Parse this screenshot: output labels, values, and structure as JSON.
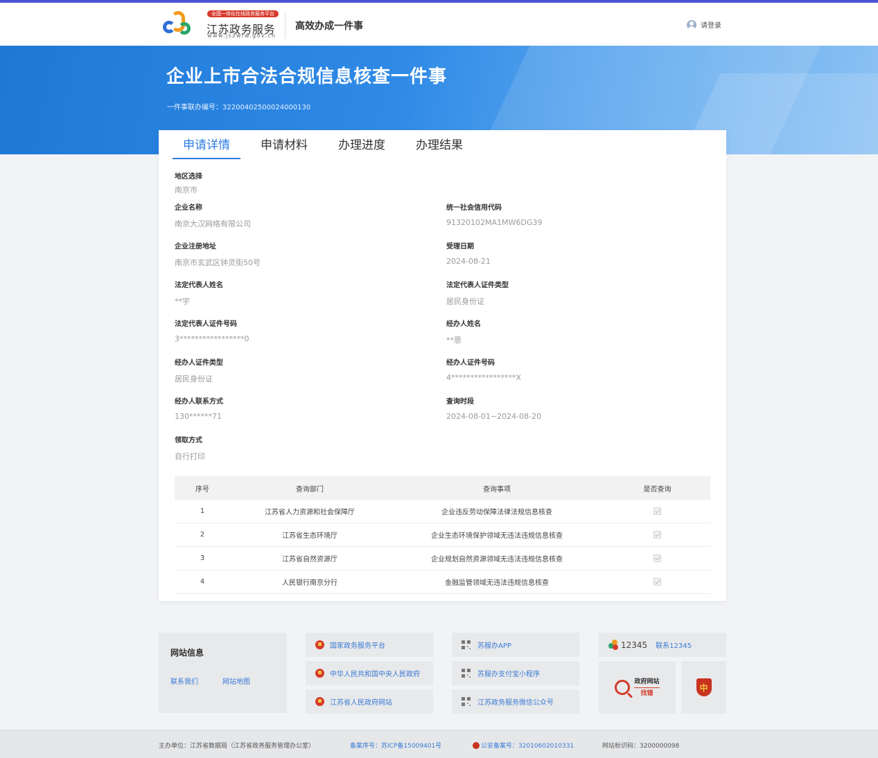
{
  "header": {
    "badge": "全国一体化在线政务服务平台",
    "brand_name": "江苏政务服务",
    "brand_url": "www.jszwfw.gov.cn",
    "slogan": "高效办成一件事",
    "login": "请登录"
  },
  "banner": {
    "title": "企业上市合法合规信息核查一件事",
    "code": "一件事联办编号：3220040250002400013​0"
  },
  "tabs": [
    {
      "label": "申请详情",
      "active": true
    },
    {
      "label": "申请材料"
    },
    {
      "label": "办理进度"
    },
    {
      "label": "办理结果"
    }
  ],
  "fields": {
    "region": {
      "label": "地区选择",
      "value": "南京市"
    },
    "company_name": {
      "label": "企业名称",
      "value": "南京大汉网络有限公司"
    },
    "credit_code": {
      "label": "统一社会信用代码",
      "value": "91320102MA1MW6DG39"
    },
    "reg_address": {
      "label": "企业注册地址",
      "value": "南京市玄武区钟灵街50号"
    },
    "accept_date": {
      "label": "受理日期",
      "value": "2024-08-21"
    },
    "legal_name": {
      "label": "法定代表人姓名",
      "value": "**宇"
    },
    "legal_id_type": {
      "label": "法定代表人证件类型",
      "value": "居民身份证"
    },
    "legal_id_no": {
      "label": "法定代表人证件号码",
      "value": "3*****************0"
    },
    "agent_name": {
      "label": "经办人姓名",
      "value": "**恩"
    },
    "agent_id_type": {
      "label": "经办人证件类型",
      "value": "居民身份证"
    },
    "agent_id_no": {
      "label": "经办人证件号码",
      "value": "4*****************X"
    },
    "agent_phone": {
      "label": "经办人联系方式",
      "value": "130******71"
    },
    "query_period": {
      "label": "查询时段",
      "value": "2024-08-01~2024-08-20"
    },
    "receive_method": {
      "label": "领取方式",
      "value": "自行打印"
    }
  },
  "table": {
    "headers": [
      "序号",
      "查询部门",
      "查询事项",
      "是否查询"
    ],
    "rows": [
      {
        "no": "1",
        "dept": "江苏省人力资源和社会保障厅",
        "item": "企业违反劳动保障法律法规信息核查",
        "checked": true
      },
      {
        "no": "2",
        "dept": "江苏省生态环境厅",
        "item": "企业生态环境保护领域无违法违规信息核查",
        "checked": true
      },
      {
        "no": "3",
        "dept": "江苏省自然资源厅",
        "item": "企业规划自然资源领域无违法违规信息核查",
        "checked": true
      },
      {
        "no": "4",
        "dept": "人民银行南京分行",
        "item": "金融监管领域无违法违规信息核查",
        "checked": true
      }
    ]
  },
  "footer": {
    "site_info_title": "网站信息",
    "contact_us": "联系我们",
    "sitemap": "网站地图",
    "gov_links": [
      "国家政务服务平台",
      "中华人民共和国中央人民政府",
      "江苏省人民政府网站"
    ],
    "app_links": [
      "苏服办APP",
      "苏服办支付宝小程序",
      "江苏政务服务微信公众号"
    ],
    "hotline_number": "12345",
    "hotline_link": "联系12345",
    "jiucuo_title": "政府网站",
    "jiucuo_sub": "找错",
    "shield_glyph": "中"
  },
  "bottom": {
    "host": "主办单位：江苏省数据局（江苏省政务服务管理办公室）",
    "icp": "备案序号：苏ICP备15009401号",
    "police": "公安备案号：32010602010331",
    "site_id": "网站标识码：3200000098"
  }
}
